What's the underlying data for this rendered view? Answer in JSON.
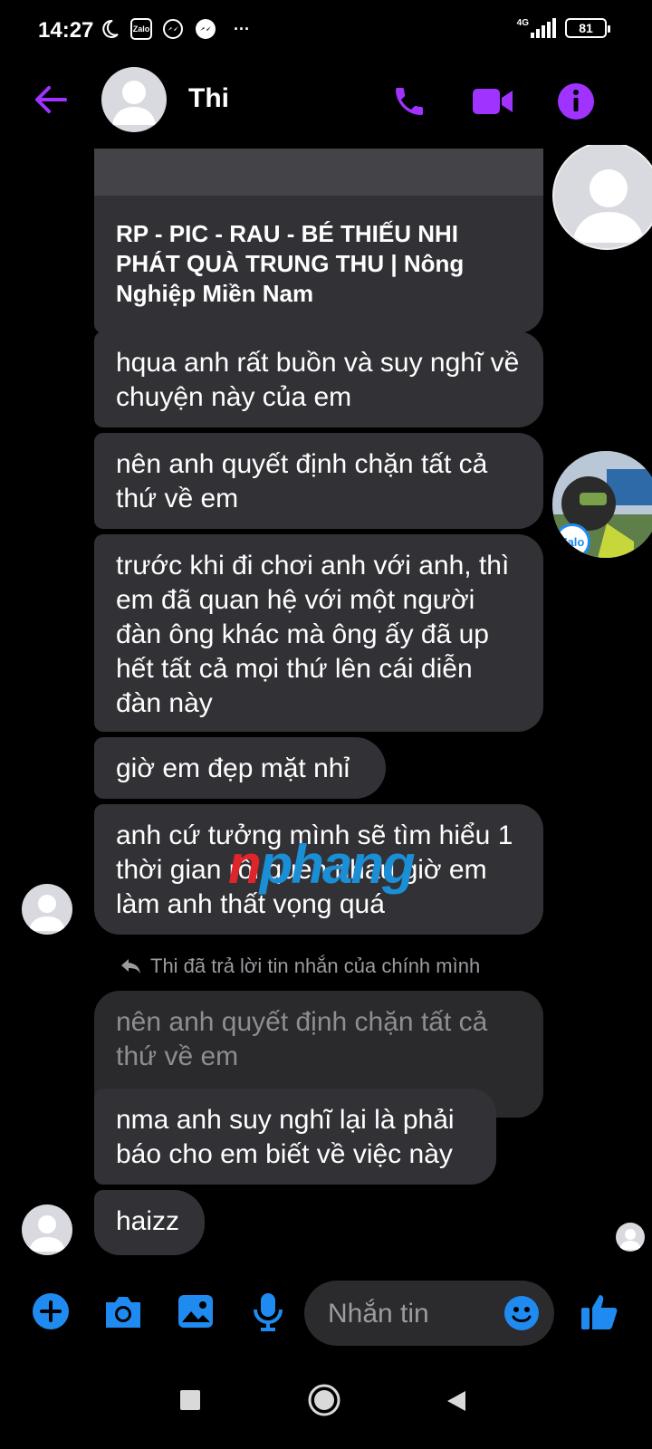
{
  "status_bar": {
    "time": "14:27",
    "zalo_label": "Zalo",
    "network": "4G",
    "battery": "81",
    "more": "···"
  },
  "header": {
    "contact_name": "Thi"
  },
  "link_card": {
    "title": "RP - PIC - RAU - BÉ THIẾU NHI PHÁT QUÀ TRUNG THU | Nông Nghiệp Miền Nam"
  },
  "messages": [
    "hqua anh rất buồn và suy nghĩ về chuyện này của em",
    "nên anh quyết định chặn tất cả thứ về em",
    "trước khi đi chơi anh với anh, thì em đã quan hệ với một người đàn ông khác mà ông ấy đã up hết tất cả mọi thứ lên cái diễn đàn này",
    "giờ em đẹp mặt nhỉ",
    "anh cứ tưởng mình sẽ tìm hiểu 1 thời gian rồi quen nhau giờ em làm anh thất vọng quá"
  ],
  "reply_note": "Thi đã trả lời tin nhắn của chính mình",
  "quoted_message": "nên anh quyết định chặn tất cả thứ về em",
  "messages_after": [
    "nma anh suy nghĩ lại là phải báo cho em biết về việc này",
    "haizz"
  ],
  "side_badge": "Zalo",
  "watermark": {
    "part1": "n",
    "part2": "phang"
  },
  "composer": {
    "placeholder": "Nhắn tin"
  },
  "colors": {
    "accent_purple": "#a033ff",
    "accent_blue": "#1f8bf0",
    "bubble": "#323236"
  }
}
